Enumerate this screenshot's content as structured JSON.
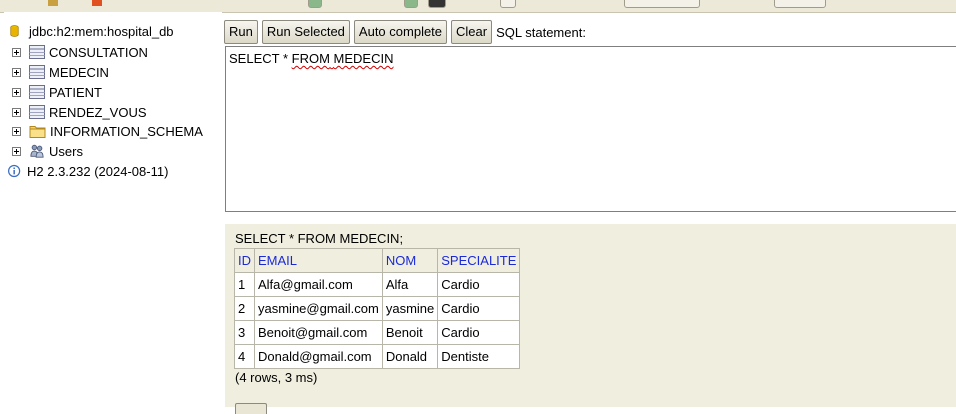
{
  "tree": {
    "database": "jdbc:h2:mem:hospital_db",
    "tables": [
      "CONSULTATION",
      "MEDECIN",
      "PATIENT",
      "RENDEZ_VOUS"
    ],
    "schema": "INFORMATION_SCHEMA",
    "users": "Users",
    "version": "H2 2.3.232 (2024-08-11)"
  },
  "toolbar": {
    "run": "Run",
    "run_selected": "Run Selected",
    "auto_complete": "Auto complete",
    "clear": "Clear",
    "sql_label": "SQL statement:"
  },
  "editor": {
    "prefix": "SELECT * ",
    "from": "FROM",
    "space": " ",
    "table": "MEDECIN"
  },
  "result": {
    "statement": "SELECT * FROM MEDECIN;",
    "columns": [
      "ID",
      "EMAIL",
      "NOM",
      "SPECIALITE"
    ],
    "rows": [
      [
        "1",
        "Alfa@gmail.com",
        "Alfa",
        "Cardio"
      ],
      [
        "2",
        "yasmine@gmail.com",
        "yasmine",
        "Cardio"
      ],
      [
        "3",
        "Benoit@gmail.com",
        "Benoit",
        "Cardio"
      ],
      [
        "4",
        "Donald@gmail.com",
        "Donald",
        "Dentiste"
      ]
    ],
    "row_count": "(4 rows, 3 ms)"
  },
  "colors": {
    "header_link": "#1a2ad8",
    "result_bg": "#f0eedf",
    "squiggle": "#d00000"
  }
}
